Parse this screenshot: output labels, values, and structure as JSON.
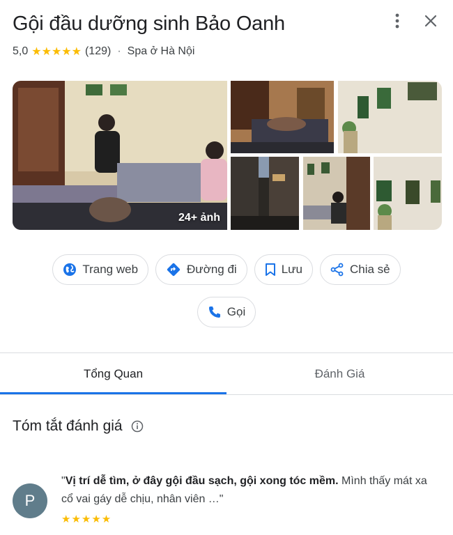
{
  "place": {
    "name": "Gội đầu dưỡng sinh Bảo Oanh",
    "rating": "5,0",
    "stars": "★★★★★",
    "review_count": "(129)",
    "separator": "·",
    "category": "Spa ở Hà Nội"
  },
  "header_icons": [
    "more-vert-icon",
    "close-icon"
  ],
  "gallery": {
    "photo_count_label": "24+ ảnh"
  },
  "actions": {
    "website": "Trang web",
    "directions": "Đường đi",
    "save": "Lưu",
    "share": "Chia sẻ",
    "call": "Gọi"
  },
  "tabs": [
    {
      "label": "Tổng Quan",
      "active": true
    },
    {
      "label": "Đánh Giá",
      "active": false
    }
  ],
  "summary": {
    "title": "Tóm tắt đánh giá"
  },
  "review": {
    "avatar_letter": "P",
    "quote_open": "\"",
    "highlight": "Vị trí dễ tìm, ở đây gội đầu sạch, gội xong tóc mềm.",
    "rest": " Mình thấy mát xa cổ vai gáy dễ chịu, nhân viên …\"",
    "stars": "★★★★★"
  },
  "colors": {
    "accent": "#1a73e8",
    "star": "#fbbc04",
    "avatar": "#607d8b"
  }
}
